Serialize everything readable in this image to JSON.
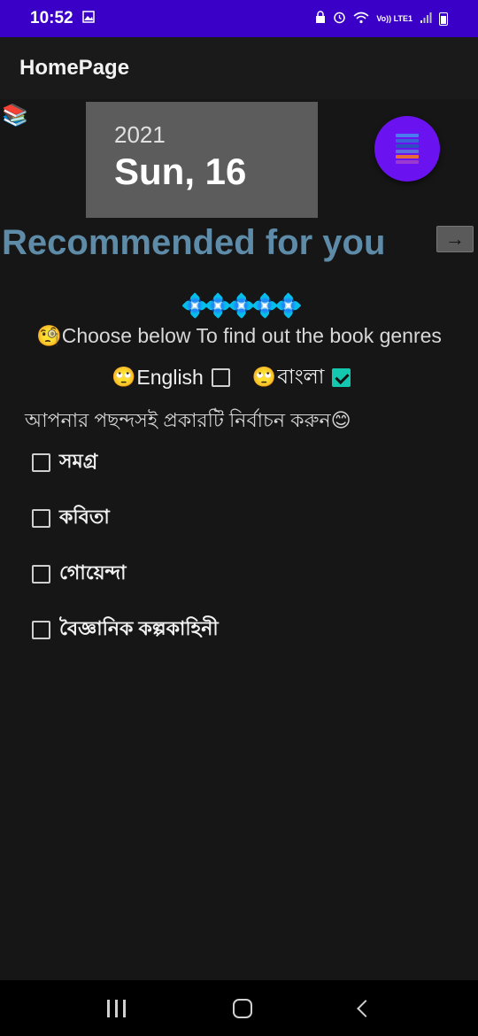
{
  "status_bar": {
    "time": "10:52",
    "network": "Vo)) LTE1",
    "icons": [
      "gallery-icon",
      "lock-icon",
      "alarm-icon",
      "wifi-icon",
      "signal-icon",
      "battery-icon"
    ]
  },
  "app_bar": {
    "title": "HomePage"
  },
  "books_icon": "📚",
  "date_card": {
    "year": "2021",
    "day": "Sun, 16"
  },
  "fab": {
    "icon": "book-stack-icon",
    "colors": [
      "#4a7cf0",
      "#3b5fd8",
      "#2e4fc2",
      "#5a6ee0",
      "#e86a3a",
      "#9b3ad0"
    ]
  },
  "recommended": {
    "title": "Recommended for you",
    "arrow": "→"
  },
  "diamonds": "💠💠💠💠💠",
  "instruction": "🧐Choose below  To find out the book genres",
  "languages": [
    {
      "emoji": "🙄",
      "label": "English",
      "checked": false
    },
    {
      "emoji": "🙄",
      "label": "বাংলা",
      "checked": true
    }
  ],
  "prompt_bn": "আপনার পছন্দসই প্রকারটি নির্বাচন করুন😊",
  "genres": [
    {
      "label": "সমগ্র",
      "checked": false
    },
    {
      "label": "কবিতা",
      "checked": false
    },
    {
      "label": "গোয়েন্দা",
      "checked": false
    },
    {
      "label": "বৈজ্ঞানিক কল্পকাহিনী",
      "checked": false
    }
  ],
  "colors": {
    "status_bar": "#3a00c8",
    "fab": "#6b12f0",
    "recommended_text": "#5e8ba8",
    "checkbox_checked": "#14c8b0",
    "date_card": "#5c5c5c"
  }
}
